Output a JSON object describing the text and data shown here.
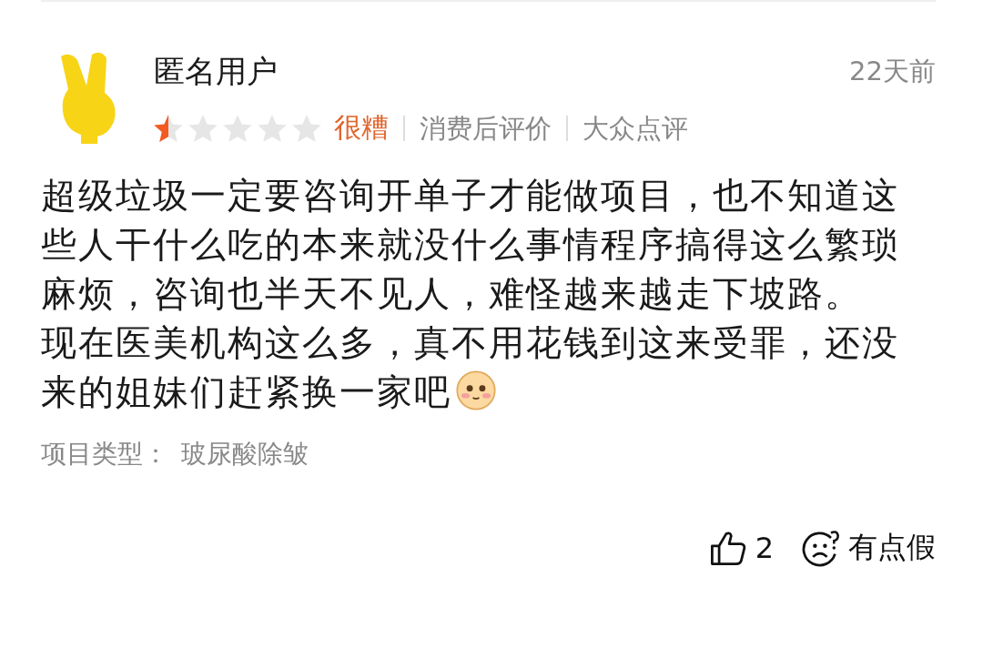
{
  "review": {
    "author": "匿名用户",
    "time": "22天前",
    "stars": 0.5,
    "rating_label": "很糟",
    "tags": [
      "消费后评价",
      "大众点评"
    ],
    "paragraphs": [
      "超级垃圾一定要咨询开单子才能做项目，也不知道这些人干什么吃的本来就没什么事情程序搞得这么繁琐麻烦，咨询也半天不见人，难怪越来越走下坡路。",
      "现在医美机构这么多，真不用花钱到这来受罪，还没来的姐妹们赶紧换一家吧"
    ],
    "project_type": {
      "label": "项目类型：",
      "value": "玻尿酸除皱"
    },
    "likes": "2",
    "reaction": "有点假"
  }
}
